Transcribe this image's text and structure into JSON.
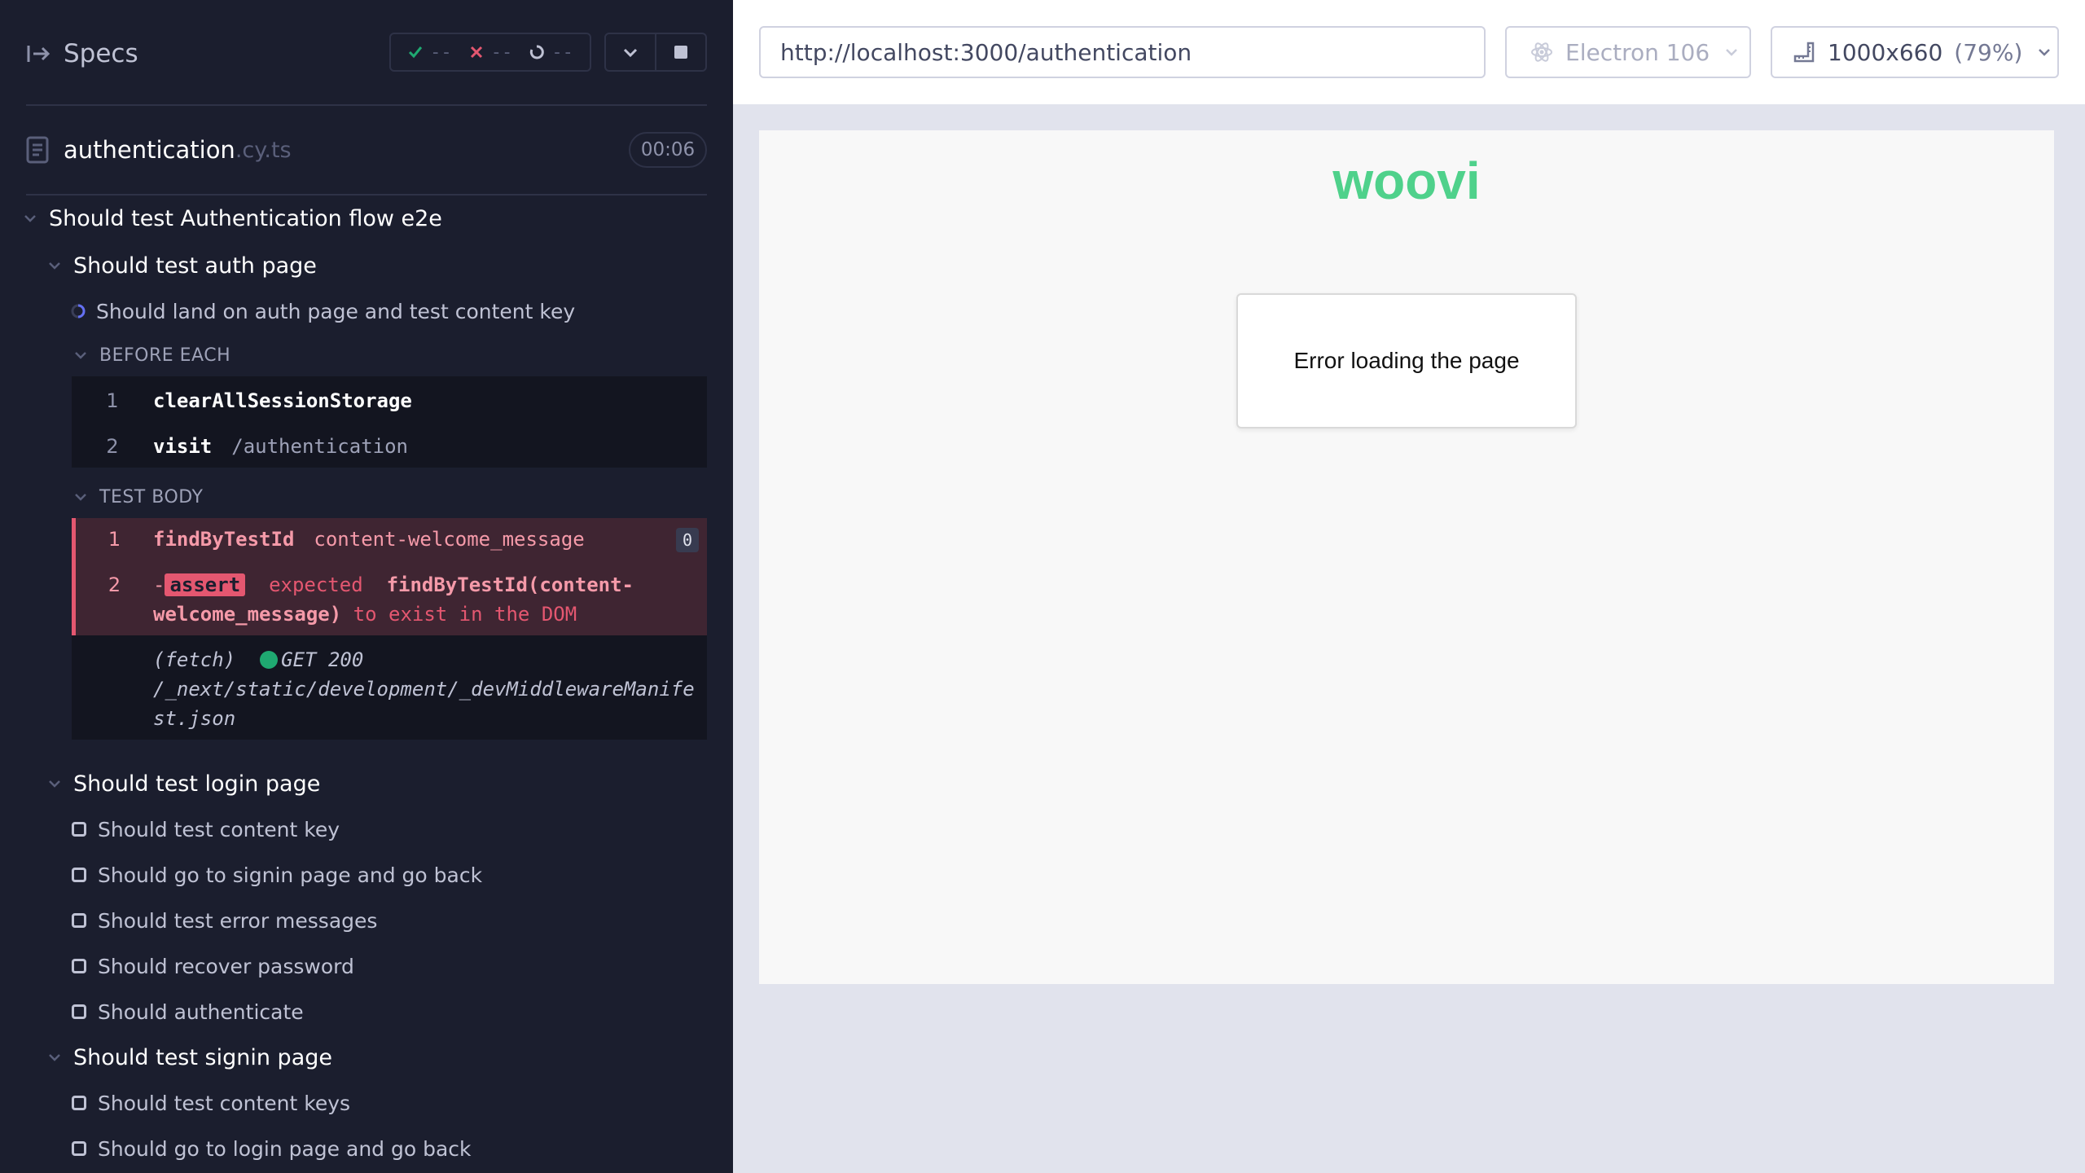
{
  "reporter": {
    "specs_label": "Specs",
    "stats": {
      "passed": "--",
      "failed": "--",
      "pending": "--"
    },
    "spec": {
      "name": "authentication",
      "ext": ".cy.ts",
      "duration": "00:06"
    },
    "suite_root": "Should test Authentication flow e2e",
    "auth_suite": {
      "title": "Should test auth page",
      "test_title": "Should land on auth page and test content key",
      "before_each_label": "BEFORE EACH",
      "before_each": [
        {
          "num": "1",
          "name": "clearAllSessionStorage",
          "msg": ""
        },
        {
          "num": "2",
          "name": "visit",
          "msg": "/authentication"
        }
      ],
      "test_body_label": "TEST BODY",
      "body_cmd": {
        "num": "1",
        "name": "findByTestId",
        "msg": "content-welcome_message",
        "badge": "0"
      },
      "assert": {
        "num": "2",
        "dash": "-",
        "tag": "assert",
        "expected": "expected",
        "subject": "findByTestId(content-welcome_message)",
        "rest": "to exist in the DOM"
      },
      "fetch": {
        "label": "(fetch)",
        "status": "GET 200",
        "path": "/_next/static/development/_devMiddlewareManifest.json"
      }
    },
    "login_suite": {
      "title": "Should test login page",
      "tests": [
        "Should test content key",
        "Should go to signin page and go back",
        "Should test error messages",
        "Should recover password",
        "Should authenticate"
      ]
    },
    "signin_suite": {
      "title": "Should test signin page",
      "tests": [
        "Should test content keys",
        "Should go to login page and go back"
      ]
    }
  },
  "aut": {
    "url": "http://localhost:3000/authentication",
    "browser": "Electron 106",
    "viewport": "1000x660",
    "viewport_pct": "(79%)",
    "page": {
      "logo_text": "woovi",
      "error_message": "Error loading the page",
      "brand_color": "#4fd18b"
    }
  }
}
